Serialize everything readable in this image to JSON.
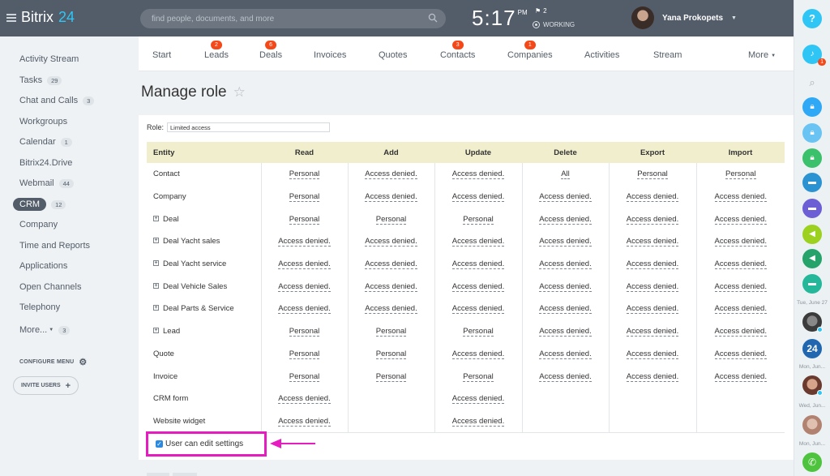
{
  "header": {
    "logo_a": "Bitrix",
    "logo_b": "24",
    "search_placeholder": "find people, documents, and more",
    "time": "5:17",
    "ampm": "PM",
    "flag_count": "2",
    "status": "WORKING",
    "user_name": "Yana Prokopets"
  },
  "right_sidebar": {
    "help": "?",
    "bell_badge": "1",
    "dates": [
      "Tue, June 27",
      "Mon, Jun...",
      "Wed, Jun...",
      "Mon, Jun..."
    ],
    "avatar2_text": "24"
  },
  "left_menu": {
    "items": [
      {
        "label": "Activity Stream",
        "count": ""
      },
      {
        "label": "Tasks",
        "count": "29"
      },
      {
        "label": "Chat and Calls",
        "count": "3"
      },
      {
        "label": "Workgroups",
        "count": ""
      },
      {
        "label": "Calendar",
        "count": "1"
      },
      {
        "label": "Bitrix24.Drive",
        "count": ""
      },
      {
        "label": "Webmail",
        "count": "44"
      },
      {
        "label": "CRM",
        "count": "12"
      },
      {
        "label": "Company",
        "count": ""
      },
      {
        "label": "Time and Reports",
        "count": ""
      },
      {
        "label": "Applications",
        "count": ""
      },
      {
        "label": "Open Channels",
        "count": ""
      },
      {
        "label": "Telephony",
        "count": ""
      },
      {
        "label": "More...",
        "count": "3"
      }
    ],
    "configure": "CONFIGURE MENU",
    "invite": "INVITE USERS"
  },
  "tabs": [
    {
      "label": "Start",
      "badge": ""
    },
    {
      "label": "Leads",
      "badge": "2"
    },
    {
      "label": "Deals",
      "badge": "6"
    },
    {
      "label": "Invoices",
      "badge": ""
    },
    {
      "label": "Quotes",
      "badge": ""
    },
    {
      "label": "Contacts",
      "badge": "3"
    },
    {
      "label": "Companies",
      "badge": "1"
    },
    {
      "label": "Activities",
      "badge": ""
    },
    {
      "label": "Stream",
      "badge": ""
    },
    {
      "label": "More",
      "badge": ""
    }
  ],
  "page": {
    "title": "Manage role",
    "role_label": "Role:",
    "role_value": "Limited access"
  },
  "table": {
    "headers": [
      "Entity",
      "Read",
      "Add",
      "Update",
      "Delete",
      "Export",
      "Import"
    ],
    "rows": [
      {
        "entity": "Contact",
        "expandable": false,
        "cells": [
          "Personal",
          "Access denied.",
          "Access denied.",
          "All",
          "Personal",
          "Personal"
        ]
      },
      {
        "entity": "Company",
        "expandable": false,
        "cells": [
          "Personal",
          "Access denied.",
          "Access denied.",
          "Access denied.",
          "Access denied.",
          "Access denied."
        ]
      },
      {
        "entity": "Deal",
        "expandable": true,
        "cells": [
          "Personal",
          "Personal",
          "Personal",
          "Access denied.",
          "Access denied.",
          "Access denied."
        ]
      },
      {
        "entity": "Deal Yacht sales",
        "expandable": true,
        "cells": [
          "Access denied.",
          "Access denied.",
          "Access denied.",
          "Access denied.",
          "Access denied.",
          "Access denied."
        ]
      },
      {
        "entity": "Deal Yacht service",
        "expandable": true,
        "cells": [
          "Access denied.",
          "Access denied.",
          "Access denied.",
          "Access denied.",
          "Access denied.",
          "Access denied."
        ]
      },
      {
        "entity": "Deal Vehicle Sales",
        "expandable": true,
        "cells": [
          "Access denied.",
          "Access denied.",
          "Access denied.",
          "Access denied.",
          "Access denied.",
          "Access denied."
        ]
      },
      {
        "entity": "Deal Parts & Service",
        "expandable": true,
        "cells": [
          "Access denied.",
          "Access denied.",
          "Access denied.",
          "Access denied.",
          "Access denied.",
          "Access denied."
        ]
      },
      {
        "entity": "Lead",
        "expandable": true,
        "cells": [
          "Personal",
          "Personal",
          "Personal",
          "Access denied.",
          "Access denied.",
          "Access denied."
        ]
      },
      {
        "entity": "Quote",
        "expandable": false,
        "cells": [
          "Personal",
          "Personal",
          "Access denied.",
          "Access denied.",
          "Access denied.",
          "Access denied."
        ]
      },
      {
        "entity": "Invoice",
        "expandable": false,
        "cells": [
          "Personal",
          "Personal",
          "Personal",
          "Access denied.",
          "Access denied.",
          "Access denied."
        ]
      },
      {
        "entity": "CRM form",
        "expandable": false,
        "cells": [
          "Access denied.",
          "",
          "Access denied.",
          "",
          "",
          ""
        ]
      },
      {
        "entity": "Website widget",
        "expandable": false,
        "cells": [
          "Access denied.",
          "",
          "Access denied.",
          "",
          "",
          ""
        ]
      }
    ]
  },
  "settings_checkbox": {
    "label": "User can edit settings",
    "checked": true
  },
  "colors": {
    "header_bg": "#535c69",
    "accent_blue": "#2fc6f6",
    "badge_red": "#f54819",
    "table_header_bg": "#f1eecd",
    "highlight_magenta": "#e61cc0"
  }
}
